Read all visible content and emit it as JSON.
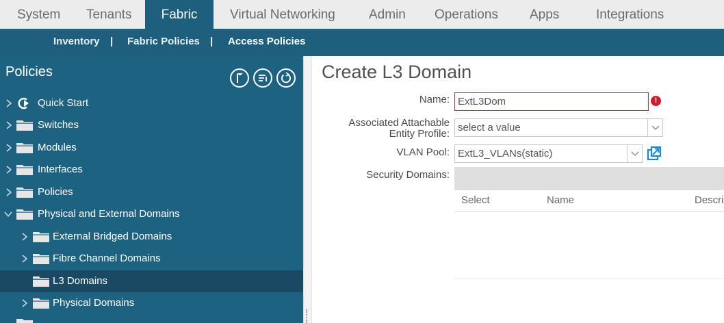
{
  "topnav": {
    "tabs": [
      {
        "label": "System"
      },
      {
        "label": "Tenants"
      },
      {
        "label": "Fabric",
        "active": true
      },
      {
        "label": "Virtual Networking"
      },
      {
        "label": "Admin"
      },
      {
        "label": "Operations"
      },
      {
        "label": "Apps"
      },
      {
        "label": "Integrations"
      }
    ]
  },
  "subnav": {
    "items": [
      {
        "label": "Inventory"
      },
      {
        "label": "Fabric Policies"
      },
      {
        "label": "Access Policies",
        "active": true
      }
    ],
    "separator": "|"
  },
  "sidebar": {
    "title": "Policies",
    "tree": [
      {
        "label": "Quick Start",
        "icon": "quick-start-icon"
      },
      {
        "label": "Switches",
        "icon": "folder-icon"
      },
      {
        "label": "Modules",
        "icon": "folder-icon"
      },
      {
        "label": "Interfaces",
        "icon": "folder-icon"
      },
      {
        "label": "Policies",
        "icon": "folder-icon"
      },
      {
        "label": "Physical and External Domains",
        "icon": "folder-icon",
        "expanded": true
      },
      {
        "label": "External Bridged Domains",
        "icon": "folder-icon"
      },
      {
        "label": "Fibre Channel Domains",
        "icon": "folder-icon"
      },
      {
        "label": "L3 Domains",
        "icon": "folder-icon",
        "selected": true
      },
      {
        "label": "Physical Domains",
        "icon": "folder-icon"
      }
    ]
  },
  "form": {
    "title": "Create L3 Domain",
    "name_label": "Name:",
    "name_value": "ExtL3Dom",
    "aaep_label_line1": "Associated Attachable",
    "aaep_label_line2": "Entity Profile:",
    "aaep_placeholder": "select a value",
    "vlan_label": "VLAN Pool:",
    "vlan_value": "ExtL3_VLANs(static)",
    "security_label": "Security Domains:",
    "table_headers": [
      "Select",
      "Name",
      "Descri"
    ],
    "error_glyph": "!"
  },
  "colors": {
    "nav_active": "#1e5f7e",
    "sidebar_bg": "#1e6282",
    "selected_row": "#1a4a63",
    "error": "#d21a2d",
    "link_icon": "#1b87c9"
  }
}
